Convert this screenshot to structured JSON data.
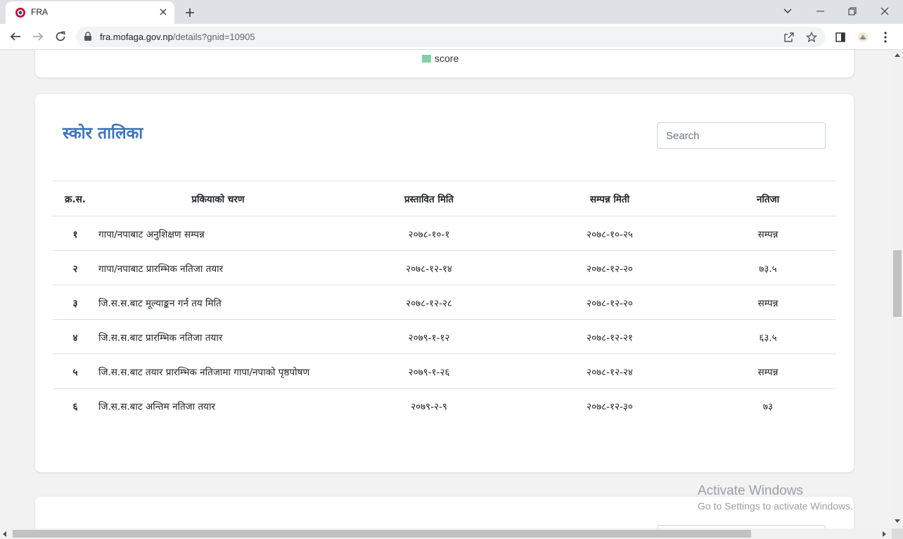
{
  "browser": {
    "tab_title": "FRA",
    "url_domain": "fra.mofaga.gov.np",
    "url_path": "/details?gnid=10905"
  },
  "chart_legend": {
    "label": "score",
    "color": "#7fd1a8"
  },
  "score_table": {
    "title": "स्कोर तालिका",
    "search_placeholder": "Search",
    "headers": {
      "sn": "क्र.स.",
      "stage": "प्रकियाको चरण",
      "proposed_date": "प्रस्तावित मिति",
      "completed_date": "सम्पन्न मिती",
      "result": "नतिजा"
    },
    "rows": [
      {
        "sn": "१",
        "stage": "गापा/नपाबाट अनुशिक्षण सम्पन्न",
        "proposed_date": "२०७८-१०-१",
        "completed_date": "२०७८-१०-२५",
        "result": "सम्पन्न"
      },
      {
        "sn": "२",
        "stage": "गापा/नपाबाट प्रारम्भिक नतिजा तयार",
        "proposed_date": "२०७८-१२-१४",
        "completed_date": "२०७८-१२-२०",
        "result": "७३.५"
      },
      {
        "sn": "३",
        "stage": "जि.स.स.बाट मूल्याङ्कन गर्न तय मिति",
        "proposed_date": "२०७८-१२-२८",
        "completed_date": "२०७८-१२-२०",
        "result": "सम्पन्न"
      },
      {
        "sn": "४",
        "stage": "जि.स.स.बाट प्रारम्भिक नतिजा तयार",
        "proposed_date": "२०७९-१-१२",
        "completed_date": "२०७८-१२-२१",
        "result": "६३.५"
      },
      {
        "sn": "५",
        "stage": "जि.स.स.बाट तयार प्रारम्भिक नतिजामा गापा/नपाको पृष्ठपोषण",
        "proposed_date": "२०७९-१-२६",
        "completed_date": "२०७८-१२-२४",
        "result": "सम्पन्न"
      },
      {
        "sn": "६",
        "stage": "जि.स.स.बाट अन्तिम नतिजा तयार",
        "proposed_date": "२०७९-२-९",
        "completed_date": "२०७८-१२-३०",
        "result": "७३"
      }
    ]
  },
  "watermark": {
    "line1": "Activate Windows",
    "line2": "Go to Settings to activate Windows."
  }
}
